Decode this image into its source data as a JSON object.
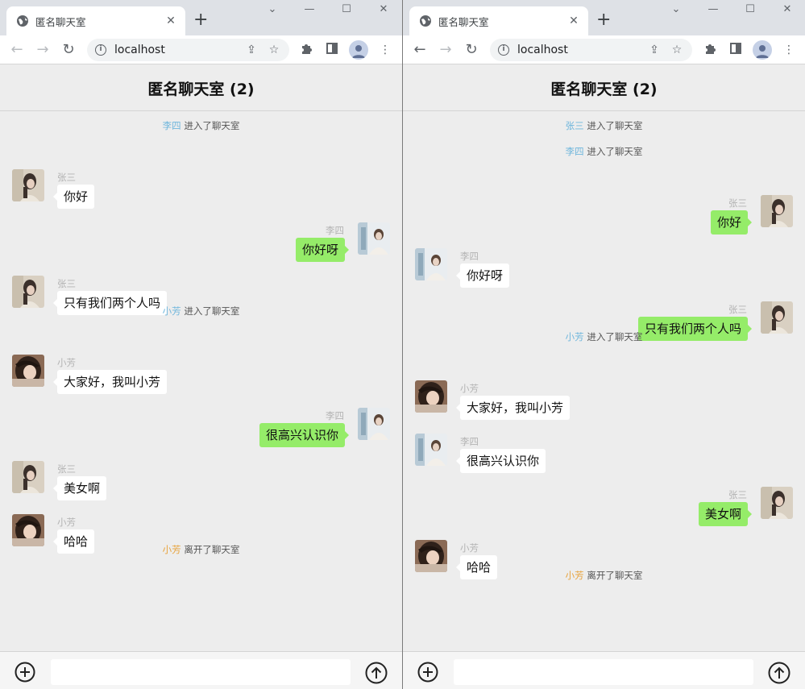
{
  "windows": [
    {
      "browser": {
        "tab_title": "匿名聊天室",
        "url": "localhost"
      },
      "chat": {
        "title": "匿名聊天室 (2)",
        "events": [
          {
            "kind": "system",
            "user": "李四",
            "text": "进入了聊天室",
            "color": "#6fb6dc"
          },
          {
            "kind": "message",
            "side": "left",
            "user": "张三",
            "text": "你好",
            "avatar": "zhangsan"
          },
          {
            "kind": "message",
            "side": "right",
            "user": "李四",
            "text": "你好呀",
            "avatar": "lisi"
          },
          {
            "kind": "message",
            "side": "left",
            "user": "张三",
            "text": "只有我们两个人吗",
            "avatar": "zhangsan"
          },
          {
            "kind": "system",
            "user": "小芳",
            "text": "进入了聊天室",
            "color": "#6fb6dc"
          },
          {
            "kind": "message",
            "side": "left",
            "user": "小芳",
            "text": "大家好，我叫小芳",
            "avatar": "xiaofang"
          },
          {
            "kind": "message",
            "side": "right",
            "user": "李四",
            "text": "很高兴认识你",
            "avatar": "lisi"
          },
          {
            "kind": "message",
            "side": "left",
            "user": "张三",
            "text": "美女啊",
            "avatar": "zhangsan"
          },
          {
            "kind": "message",
            "side": "left",
            "user": "小芳",
            "text": "哈哈",
            "avatar": "xiaofang"
          },
          {
            "kind": "system",
            "user": "小芳",
            "text": "离开了聊天室",
            "color": "#e7a23a"
          }
        ],
        "input_value": ""
      }
    },
    {
      "browser": {
        "tab_title": "匿名聊天室",
        "url": "localhost"
      },
      "chat": {
        "title": "匿名聊天室 (2)",
        "events": [
          {
            "kind": "system",
            "user": "张三",
            "text": "进入了聊天室",
            "color": "#6fb6dc"
          },
          {
            "kind": "system",
            "user": "李四",
            "text": "进入了聊天室",
            "color": "#6fb6dc"
          },
          {
            "kind": "message",
            "side": "right",
            "user": "张三",
            "text": "你好",
            "avatar": "zhangsan"
          },
          {
            "kind": "message",
            "side": "left",
            "user": "李四",
            "text": "你好呀",
            "avatar": "lisi"
          },
          {
            "kind": "message",
            "side": "right",
            "user": "张三",
            "text": "只有我们两个人吗",
            "avatar": "zhangsan"
          },
          {
            "kind": "system",
            "user": "小芳",
            "text": "进入了聊天室",
            "color": "#6fb6dc"
          },
          {
            "kind": "message",
            "side": "left",
            "user": "小芳",
            "text": "大家好，我叫小芳",
            "avatar": "xiaofang"
          },
          {
            "kind": "message",
            "side": "left",
            "user": "李四",
            "text": "很高兴认识你",
            "avatar": "lisi"
          },
          {
            "kind": "message",
            "side": "right",
            "user": "张三",
            "text": "美女啊",
            "avatar": "zhangsan"
          },
          {
            "kind": "message",
            "side": "left",
            "user": "小芳",
            "text": "哈哈",
            "avatar": "xiaofang"
          },
          {
            "kind": "system",
            "user": "小芳",
            "text": "离开了聊天室",
            "color": "#e7a23a"
          }
        ],
        "input_value": ""
      }
    }
  ],
  "colors": {
    "own_bubble": "#95ec69",
    "other_bubble": "#ffffff",
    "join_name": "#6fb6dc",
    "leave_name": "#e7a23a",
    "page_bg": "#ededed"
  },
  "icons": {
    "tab": "globe-icon",
    "nav": [
      "back-arrow-icon",
      "forward-arrow-icon",
      "reload-icon"
    ],
    "omnibox": [
      "info-icon",
      "share-icon",
      "star-icon"
    ],
    "toolbar": [
      "extensions-puzzle-icon",
      "side-panel-icon",
      "profile-avatar-icon",
      "kebab-menu-icon"
    ],
    "footer": [
      "plus-circle-icon",
      "send-arrow-up-icon"
    ]
  }
}
